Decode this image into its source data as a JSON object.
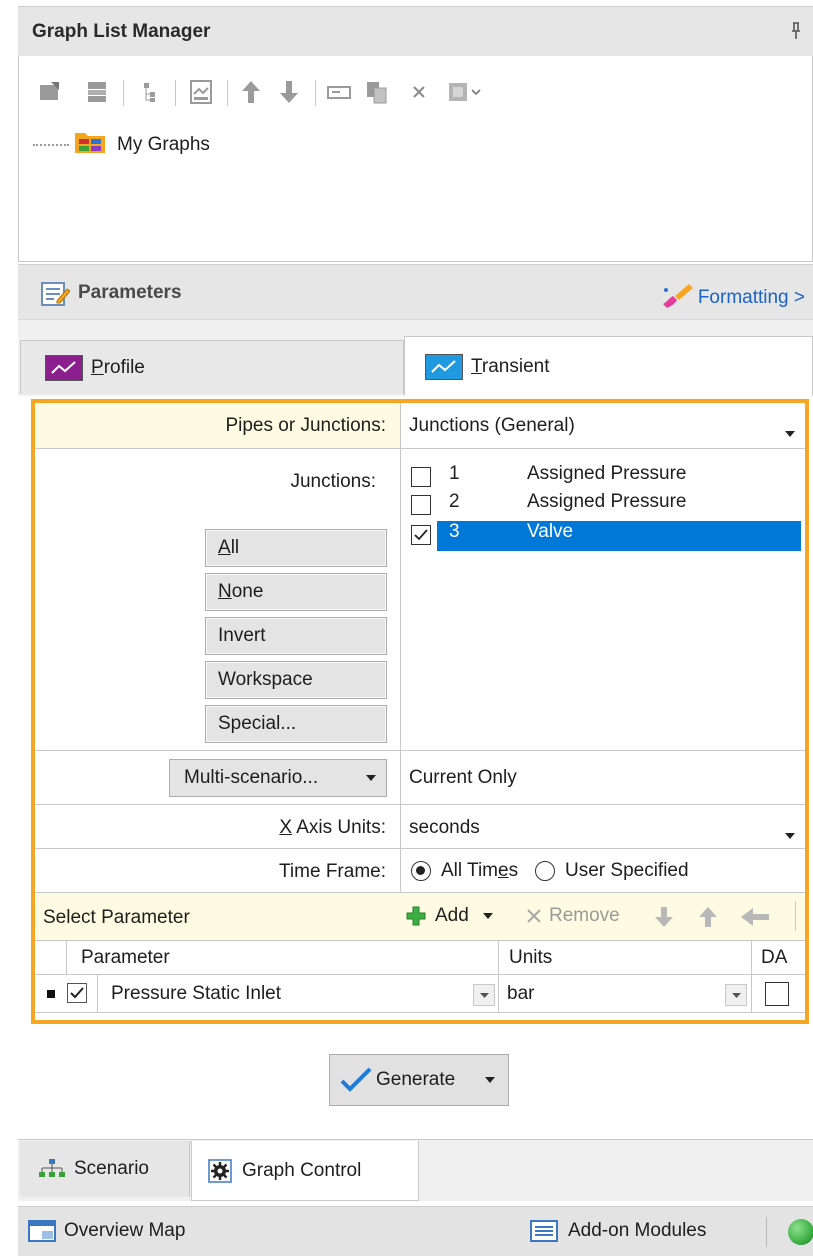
{
  "graph_list_manager": {
    "title": "Graph List Manager",
    "toolbar_icons": [
      "new-graph-icon",
      "new-list-icon",
      "tree-icon",
      "save-graph-icon",
      "move-up-icon",
      "move-down-icon",
      "rename-icon",
      "copy-icon",
      "delete-icon",
      "folder-options-icon"
    ],
    "tree": [
      {
        "label": "My Graphs"
      }
    ]
  },
  "parameters": {
    "title": "Parameters",
    "formatting_link": "Formatting >"
  },
  "tabs": [
    {
      "label_pre": "",
      "label_underline": "P",
      "label_post": "rofile"
    },
    {
      "label_pre": "",
      "label_underline": "T",
      "label_post": "ransient"
    }
  ],
  "form": {
    "pipes_or_junctions_label": "Pipes or Junctions:",
    "pipes_or_junctions_value": "Junctions (General)",
    "junctions_label": "Junctions:",
    "junctions": [
      {
        "number": "1",
        "type": "Assigned Pressure",
        "checked": false
      },
      {
        "number": "2",
        "type": "Assigned Pressure",
        "checked": false
      },
      {
        "number": "3",
        "type": "Valve",
        "checked": true
      }
    ],
    "buttons": {
      "all": {
        "u": "A",
        "rest": "ll"
      },
      "none": {
        "u": "N",
        "rest": "one"
      },
      "invert": "Invert",
      "workspace": "Workspace",
      "special": "Special..."
    },
    "multi_scenario_label": "Multi-scenario...",
    "multi_scenario_value": "Current Only",
    "x_axis_label_u": "X",
    "x_axis_label_rest": " Axis Units:",
    "x_axis_value": "seconds",
    "time_frame_label": "Time Frame:",
    "time_frame_options": {
      "all_times_pre": "All Tim",
      "all_times_u": "e",
      "all_times_post": "s",
      "user_specified": "User Specified",
      "selected": "All Times"
    },
    "select_parameter_label": "Select Parameter",
    "add_label": "Add",
    "remove_label": "Remove",
    "table_headers": {
      "parameter": "Parameter",
      "units": "Units",
      "da": "DA"
    },
    "table_rows": [
      {
        "checked": true,
        "parameter": "Pressure Static Inlet",
        "units": "bar",
        "da": false
      }
    ]
  },
  "generate_label": "Generate",
  "bottom_tabs": {
    "scenario": "Scenario",
    "graph_control": "Graph Control"
  },
  "status_bar": {
    "overview_map": "Overview Map",
    "add_on_modules": "Add-on Modules"
  },
  "colors": {
    "accent_orange": "#f5a623",
    "selection_blue": "#0078d7",
    "link_blue": "#1a63c9",
    "status_green": "#3cb043"
  }
}
